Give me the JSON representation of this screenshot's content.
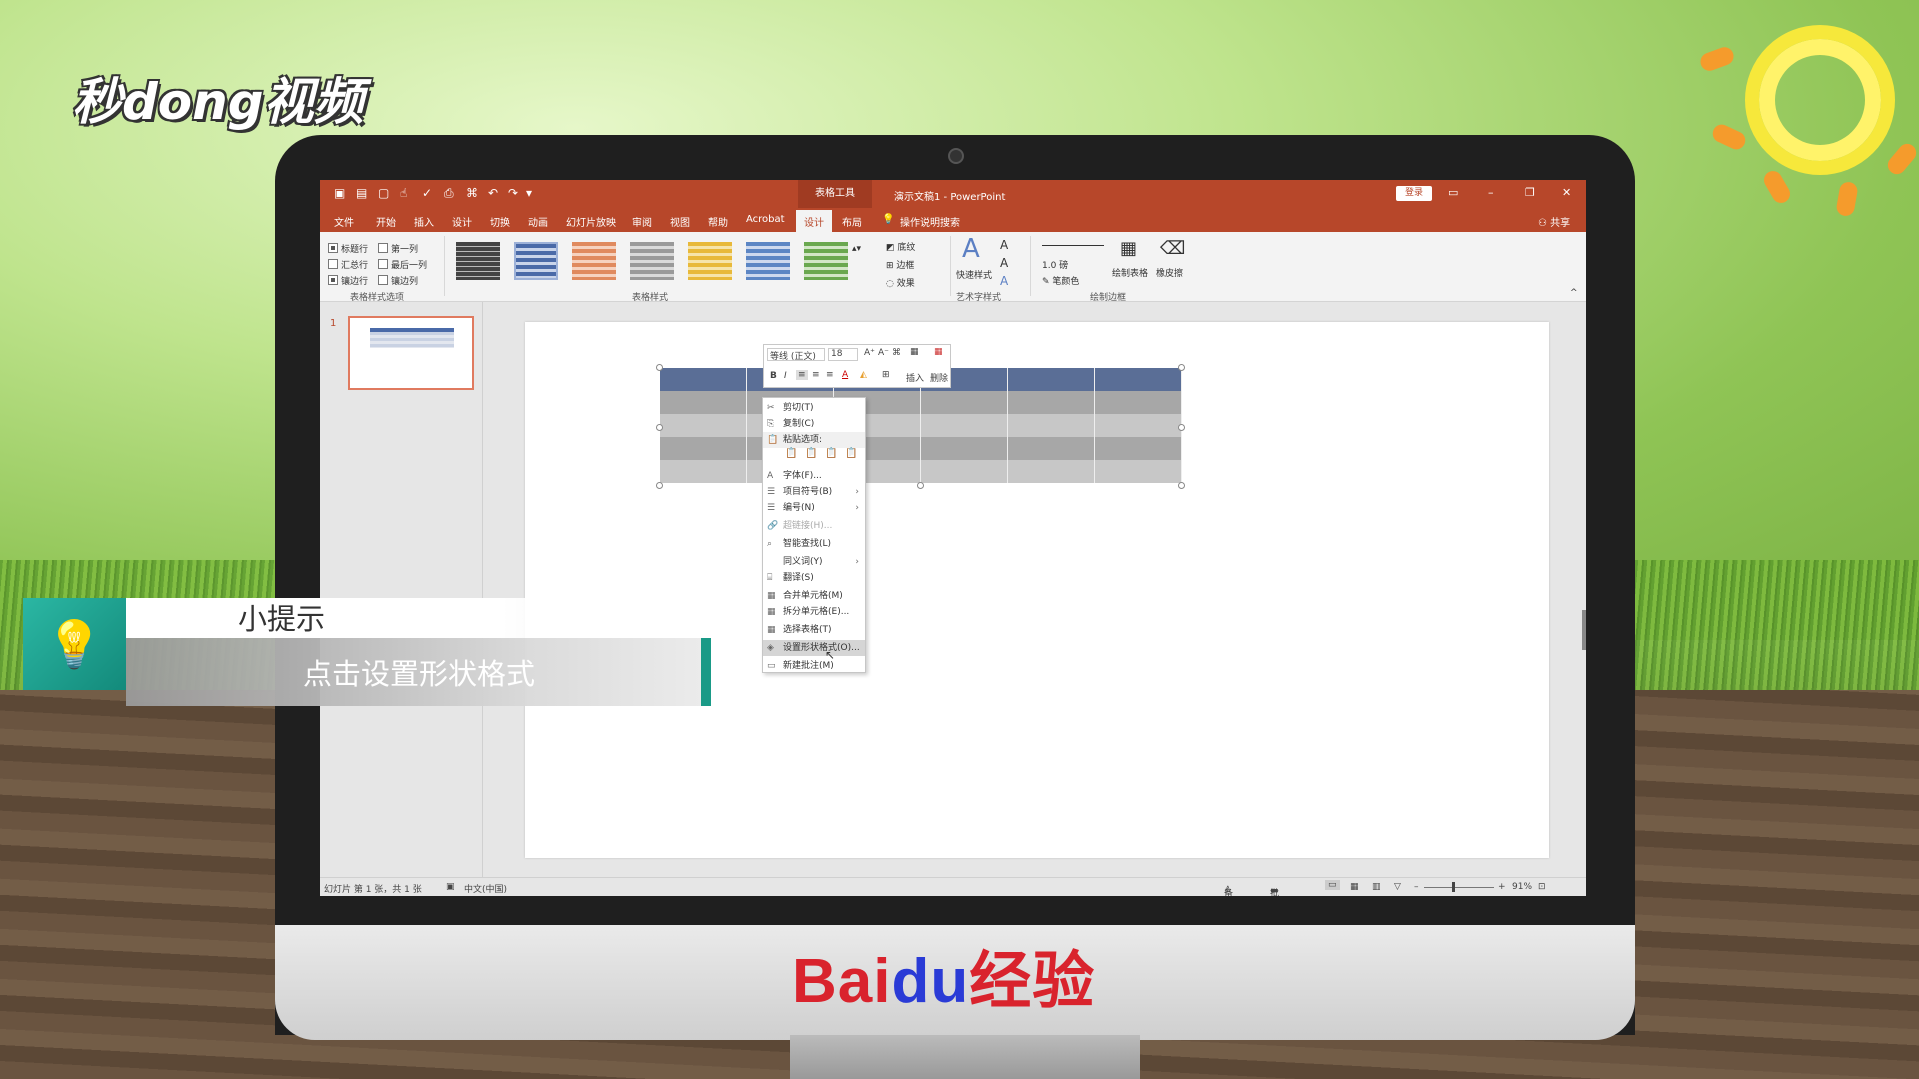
{
  "overlay": {
    "logo": "秒dong视频",
    "tip_title": "小提示",
    "tip_text": "点击设置形状格式",
    "brand": {
      "part1": "Bai",
      "part2": "du",
      "part3": "经验"
    }
  },
  "app": {
    "table_tools": "表格工具",
    "title": "演示文稿1 - PowerPoint",
    "login": "登录",
    "share": "共享"
  },
  "tabs": [
    "文件",
    "开始",
    "插入",
    "设计",
    "切换",
    "动画",
    "幻灯片放映",
    "审阅",
    "视图",
    "帮助",
    "Acrobat",
    "设计",
    "布局"
  ],
  "tell_me": "操作说明搜索",
  "ribbon": {
    "options": {
      "header_row": "标题行",
      "first_col": "第一列",
      "total_row": "汇总行",
      "last_col": "最后一列",
      "banded_rows": "镶边行",
      "banded_cols": "镶边列",
      "group_label": "表格样式选项"
    },
    "styles_label": "表格样式",
    "shading": "底纹",
    "borders": "边框",
    "effects": "效果",
    "quick_styles": "快速样式",
    "art_label": "艺术字样式",
    "pen_weight": "1.0 磅",
    "pen_color": "笔颜色",
    "draw_table": "绘制表格",
    "eraser": "橡皮擦",
    "draw_borders_label": "绘制边框"
  },
  "thumb_number": "1",
  "mini_toolbar": {
    "font": "等线 (正文)",
    "size": "18",
    "bold": "B",
    "italic": "I",
    "insert": "插入",
    "delete": "删除"
  },
  "context_menu": [
    {
      "label": "剪切(T)",
      "icon": "✂",
      "state": "normal"
    },
    {
      "label": "复制(C)",
      "icon": "⎘",
      "state": "normal"
    },
    {
      "label": "粘贴选项:",
      "icon": "📋",
      "state": "normal"
    },
    {
      "label": "字体(F)...",
      "icon": "A",
      "state": "normal"
    },
    {
      "label": "项目符号(B)",
      "icon": "☰",
      "state": "normal",
      "sub": true
    },
    {
      "label": "编号(N)",
      "icon": "☰",
      "state": "normal",
      "sub": true
    },
    {
      "label": "超链接(H)...",
      "icon": "🔗",
      "state": "disabled"
    },
    {
      "label": "智能查找(L)",
      "icon": "⌕",
      "state": "normal"
    },
    {
      "label": "同义词(Y)",
      "icon": "",
      "state": "normal",
      "sub": true
    },
    {
      "label": "翻译(S)",
      "icon": "⌸",
      "state": "normal"
    },
    {
      "label": "合并单元格(M)",
      "icon": "▦",
      "state": "normal"
    },
    {
      "label": "拆分单元格(E)...",
      "icon": "▦",
      "state": "normal"
    },
    {
      "label": "选择表格(T)",
      "icon": "▦",
      "state": "normal"
    },
    {
      "label": "设置形状格式(O)...",
      "icon": "◈",
      "state": "highlighted"
    },
    {
      "label": "新建批注(M)",
      "icon": "▭",
      "state": "normal"
    }
  ],
  "status": {
    "slide_info": "幻灯片 第 1 张，共 1 张",
    "language": "中文(中国)",
    "notes": "备注",
    "comments": "批注",
    "zoom": "91%"
  },
  "colors": {
    "ppt_accent": "#b7472a",
    "table_header": "#5a6e96",
    "tip_accent": "#1a9a87",
    "baidu_red": "#d9232d",
    "baidu_blue": "#2a3bd6"
  }
}
